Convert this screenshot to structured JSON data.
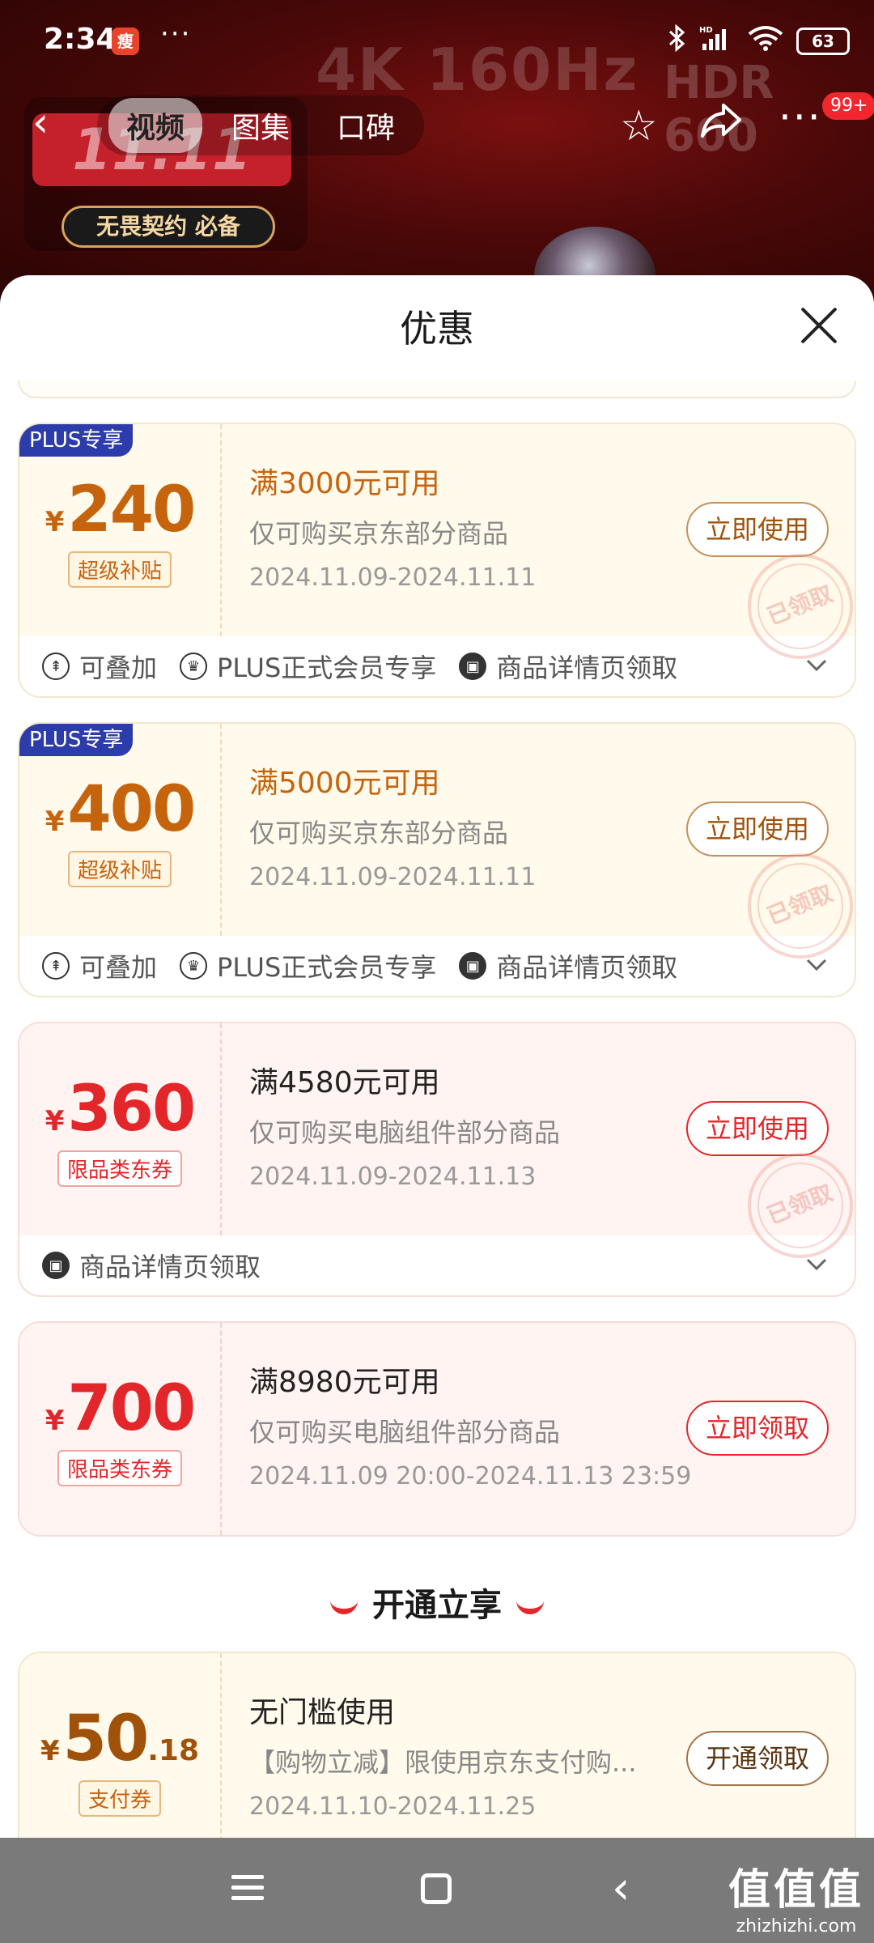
{
  "status_bar": {
    "time": "2:34",
    "app_icon_glyph": "瘦",
    "dots": "···",
    "icons": [
      "bluetooth-icon",
      "signal-hd-icon",
      "wifi-icon"
    ],
    "battery": "63"
  },
  "hero": {
    "text_4k": "4K 160Hz",
    "text_hdr": "HDR 600",
    "promo_number": "11.11",
    "slogan": "无畏契约 必备"
  },
  "top_nav": {
    "tabs": [
      {
        "label": "视频",
        "active": true
      },
      {
        "label": "图集",
        "active": false
      },
      {
        "label": "口碑",
        "active": false
      }
    ],
    "badge": "99+"
  },
  "sheet": {
    "title": "优惠"
  },
  "coupons": [
    {
      "style": "gold",
      "plus_tag": "PLUS专享",
      "yen": "¥",
      "amount": "240",
      "tag": "超级补贴",
      "condition": "满3000元可用",
      "desc": "仅可购买京东部分商品",
      "date": "2024.11.09-2024.11.11",
      "button": "立即使用",
      "stamp": "已领取",
      "footer": [
        {
          "icon": "stack-icon",
          "label": "可叠加"
        },
        {
          "icon": "crown-icon",
          "label": "PLUS正式会员专享"
        },
        {
          "icon": "ticket-icon",
          "label": "商品详情页领取"
        }
      ]
    },
    {
      "style": "gold",
      "plus_tag": "PLUS专享",
      "yen": "¥",
      "amount": "400",
      "tag": "超级补贴",
      "condition": "满5000元可用",
      "desc": "仅可购买京东部分商品",
      "date": "2024.11.09-2024.11.11",
      "button": "立即使用",
      "stamp": "已领取",
      "footer": [
        {
          "icon": "stack-icon",
          "label": "可叠加"
        },
        {
          "icon": "crown-icon",
          "label": "PLUS正式会员专享"
        },
        {
          "icon": "ticket-icon",
          "label": "商品详情页领取"
        }
      ]
    },
    {
      "style": "red",
      "yen": "¥",
      "amount": "360",
      "tag": "限品类东券",
      "condition": "满4580元可用",
      "desc": "仅可购买电脑组件部分商品",
      "date": "2024.11.09-2024.11.13",
      "button": "立即使用",
      "stamp": "已领取",
      "footer": [
        {
          "icon": "ticket-icon",
          "label": "商品详情页领取"
        }
      ]
    },
    {
      "style": "red",
      "yen": "¥",
      "amount": "700",
      "tag": "限品类东券",
      "condition": "满8980元可用",
      "desc": "仅可购买电脑组件部分商品",
      "date": "2024.11.09 20:00-2024.11.13 23:59",
      "button": "立即领取"
    }
  ],
  "section": {
    "title": "开通立享"
  },
  "pay_coupon": {
    "yen": "¥",
    "amount": "50",
    "decimal": ".18",
    "tag": "支付券",
    "condition": "无门槛使用",
    "desc": "【购物立减】限使用京东支付购...",
    "date": "2024.11.10-2024.11.25",
    "button": "开通领取"
  },
  "bottom_nav": {
    "watermark_main": "值值值",
    "watermark_sub": "zhizhizhi.com"
  }
}
